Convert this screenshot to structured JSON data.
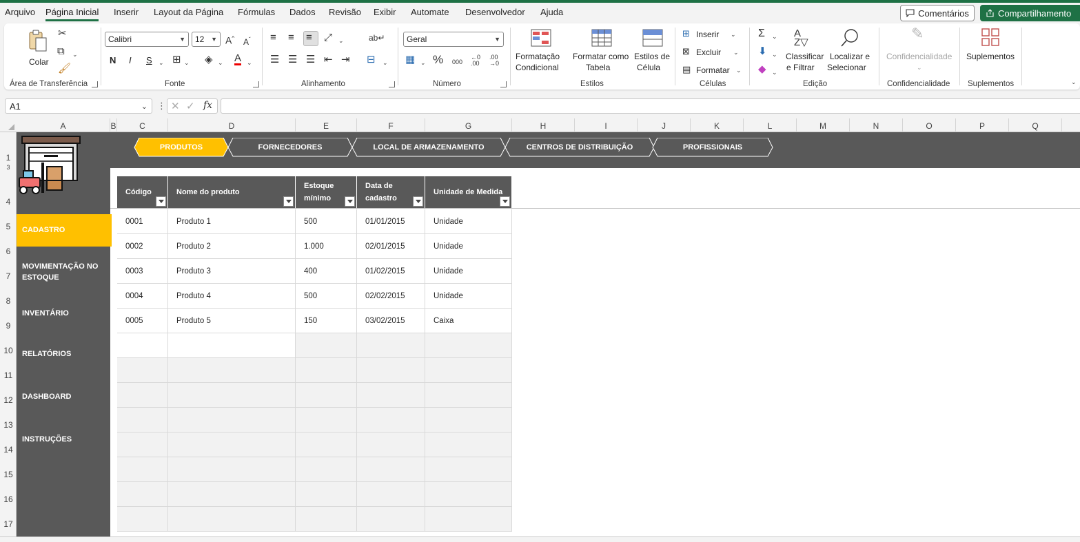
{
  "menu": {
    "items": [
      "Arquivo",
      "Página Inicial",
      "Inserir",
      "Layout da Página",
      "Fórmulas",
      "Dados",
      "Revisão",
      "Exibir",
      "Automate",
      "Desenvolvedor",
      "Ajuda"
    ],
    "comments_label": "Comentários",
    "share_label": "Compartilhamento"
  },
  "ribbon": {
    "clipboard": {
      "paste_label": "Colar",
      "group_label": "Área de Transferência"
    },
    "font": {
      "name": "Calibri",
      "size": "12",
      "bold": "N",
      "italic": "I",
      "underline": "S",
      "group_label": "Fonte"
    },
    "alignment": {
      "group_label": "Alinhamento"
    },
    "number": {
      "format": "Geral",
      "group_label": "Número"
    },
    "styles": {
      "conditional_l1": "Formatação",
      "conditional_l2": "Condicional",
      "table_l1": "Formatar como",
      "table_l2": "Tabela",
      "cell_l1": "Estilos de",
      "cell_l2": "Célula",
      "group_label": "Estilos"
    },
    "cells": {
      "insert": "Inserir",
      "delete": "Excluir",
      "format": "Formatar",
      "group_label": "Células"
    },
    "editing": {
      "sort_l1": "Classificar",
      "sort_l2": "e Filtrar",
      "find_l1": "Localizar e",
      "find_l2": "Selecionar",
      "group_label": "Edição"
    },
    "sensitivity": {
      "label": "Confidencialidade",
      "group_label": "Confidencialidade"
    },
    "addins": {
      "label": "Suplementos",
      "group_label": "Suplementos"
    }
  },
  "formula_bar": {
    "cell_ref": "A1",
    "fx": "fx",
    "formula": ""
  },
  "columns": [
    "A",
    "B",
    "C",
    "D",
    "E",
    "F",
    "G",
    "H",
    "I",
    "J",
    "K",
    "L",
    "M",
    "N",
    "O",
    "P",
    "Q"
  ],
  "rows": [
    "1",
    "3",
    "4",
    "5",
    "6",
    "7",
    "8",
    "9",
    "10",
    "11",
    "12",
    "13",
    "14",
    "15",
    "16",
    "17"
  ],
  "nav_tabs": [
    "PRODUTOS",
    "FORNECEDORES",
    "LOCAL DE ARMAZENAMENTO",
    "CENTROS DE DISTRIBUIÇÃO",
    "PROFISSIONAIS"
  ],
  "sidebar": {
    "active": "CADASTRO",
    "items": [
      "MOVIMENTAÇÃO NO",
      "ESTOQUE",
      "INVENTÁRIO",
      "RELATÓRIOS",
      "DASHBOARD",
      "INSTRUÇÕES"
    ]
  },
  "table": {
    "headers": [
      {
        "l1": "Código",
        "l2": ""
      },
      {
        "l1": "Nome do produto",
        "l2": ""
      },
      {
        "l1": "Estoque",
        "l2": "mínimo"
      },
      {
        "l1": "Data de",
        "l2": "cadastro"
      },
      {
        "l1": "Unidade de Medida",
        "l2": ""
      }
    ],
    "rows": [
      [
        "0001",
        "Produto 1",
        "500",
        "01/01/2015",
        "Unidade"
      ],
      [
        "0002",
        "Produto 2",
        "1.000",
        "02/01/2015",
        "Unidade"
      ],
      [
        "0003",
        "Produto 3",
        "400",
        "01/02/2015",
        "Unidade"
      ],
      [
        "0004",
        "Produto 4",
        "500",
        "02/02/2015",
        "Unidade"
      ],
      [
        "0005",
        "Produto 5",
        "150",
        "03/02/2015",
        "Caixa"
      ]
    ]
  },
  "colors": {
    "excel_green": "#1e7145",
    "dark_gray": "#595959",
    "accent_yellow": "#ffc000"
  }
}
